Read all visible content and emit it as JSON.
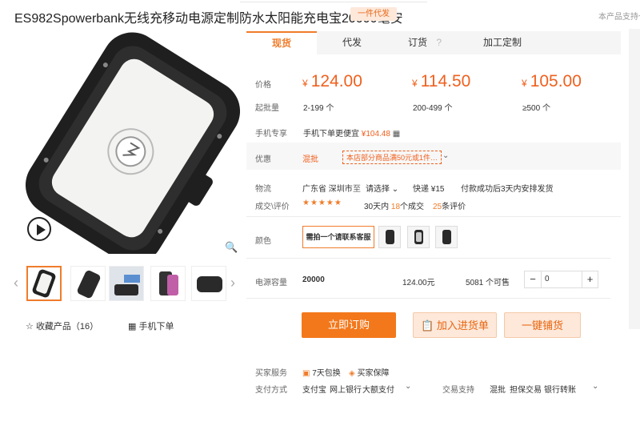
{
  "product": {
    "title": "ES982Spowerbank无线充移动电源定制防水太阳能充电宝20000毫安",
    "badge": "一件代发",
    "top_right": "本产品支持七"
  },
  "tabs": [
    "现货",
    "代发",
    "订货",
    "加工定制"
  ],
  "tabs_help_icon": "help-circle-icon",
  "price": {
    "label": "价格",
    "currency": "¥",
    "tiers": [
      {
        "price": "124.00",
        "qty": "2-199 个"
      },
      {
        "price": "114.50",
        "qty": "200-499 个"
      },
      {
        "price": "105.00",
        "qty": "≥500 个"
      }
    ],
    "qty_label": "起批量"
  },
  "mobile_deal": {
    "label": "手机专享",
    "text": "手机下单更便宜",
    "price": "¥104.48"
  },
  "promo": {
    "label": "优惠",
    "tag": "混批",
    "coupon": "本店部分商品满50元或1件…"
  },
  "logistics": {
    "label": "物流",
    "from": "广东省 深圳市",
    "to_word": "至",
    "select": "请选择",
    "express": "快递 ¥15",
    "ship_note": "付款成功后3天内安排发货"
  },
  "deals": {
    "label": "成交\\评价",
    "stars": "★★★★★",
    "days": "30天内",
    "count": "18",
    "count_unit": "个成交",
    "reviews": "25",
    "reviews_unit": "条评价"
  },
  "color": {
    "label": "颜色",
    "first_option": "需拍一个请联系客服"
  },
  "sku": {
    "label": "电源容量",
    "value": "20000",
    "price": "124.00元",
    "stock": "5081 个可售",
    "quantity": "0",
    "minus": "−",
    "plus": "+"
  },
  "buttons": {
    "buy": "立即订购",
    "cart": "加入进货单",
    "dropship": "一键铺货"
  },
  "services": {
    "label": "买家服务",
    "items": [
      "7天包换",
      "买家保障"
    ]
  },
  "payment": {
    "label": "支付方式",
    "items": [
      "支付宝",
      "网上银行",
      "大额支付"
    ],
    "trade_label": "交易支持",
    "trade_items": [
      "混批",
      "担保交易",
      "银行转账"
    ]
  },
  "gallery": {
    "fav": "收藏产品（16）",
    "mobile_order": "手机下单"
  },
  "colors": {
    "accent": "#f07c2b",
    "price": "#f0601e"
  }
}
